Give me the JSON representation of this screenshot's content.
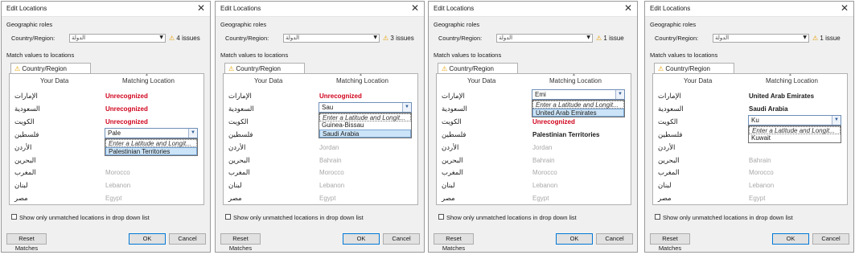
{
  "dialogs": [
    {
      "title": "Edit Locations",
      "geographic_roles_label": "Geographic roles",
      "country_region_label": "Country/Region:",
      "role_field_value": "الدولة",
      "issues": "4 issues",
      "match_label": "Match values to locations",
      "tab_label": "Country/Region",
      "col_your_data": "Your Data",
      "col_matching": "Matching Location",
      "rows": [
        {
          "data": "الإمارات",
          "match": "Unrecognized",
          "style": "unrec"
        },
        {
          "data": "السعودية",
          "match": "Unrecognized",
          "style": "unrec"
        },
        {
          "data": "الكويت",
          "match": "Unrecognized",
          "style": "unrec"
        },
        {
          "data": "فلسطين",
          "match": "",
          "style": "grey"
        },
        {
          "data": "الأردن",
          "match": "",
          "style": "grey"
        },
        {
          "data": "البحرين",
          "match": "",
          "style": "grey"
        },
        {
          "data": "المغرب",
          "match": "Morocco",
          "style": "grey"
        },
        {
          "data": "لبنان",
          "match": "Lebanon",
          "style": "grey"
        },
        {
          "data": "مصر",
          "match": "Egypt",
          "style": "grey"
        }
      ],
      "edit_value": "Pale",
      "edit_row": 3,
      "dropdown_hint": "Enter a Latitude and Longit...",
      "dropdown_items": [
        "Palestinian Territories"
      ],
      "selected_item": 0,
      "checkbox_label": "Show only unmatched locations in drop down list",
      "reset_label": "Reset Matches",
      "ok_label": "OK",
      "cancel_label": "Cancel"
    },
    {
      "title": "Edit Locations",
      "geographic_roles_label": "Geographic roles",
      "country_region_label": "Country/Region:",
      "role_field_value": "الدولة",
      "issues": "3 issues",
      "match_label": "Match values to locations",
      "tab_label": "Country/Region",
      "col_your_data": "Your Data",
      "col_matching": "Matching Location",
      "rows": [
        {
          "data": "الإمارات",
          "match": "Unrecognized",
          "style": "unrec"
        },
        {
          "data": "السعودية",
          "match": "",
          "style": "grey"
        },
        {
          "data": "الكويت",
          "match": "",
          "style": "grey"
        },
        {
          "data": "فلسطين",
          "match": "",
          "style": "grey"
        },
        {
          "data": "الأردن",
          "match": "Jordan",
          "style": "grey"
        },
        {
          "data": "البحرين",
          "match": "Bahrain",
          "style": "grey"
        },
        {
          "data": "المغرب",
          "match": "Morocco",
          "style": "grey"
        },
        {
          "data": "لبنان",
          "match": "Lebanon",
          "style": "grey"
        },
        {
          "data": "مصر",
          "match": "Egypt",
          "style": "grey"
        }
      ],
      "edit_value": "Sau",
      "edit_row": 1,
      "dropdown_hint": "Enter a Latitude and Longit...",
      "dropdown_items": [
        "Guinea-Bissau",
        "Saudi Arabia"
      ],
      "selected_item": 1,
      "checkbox_label": "Show only unmatched locations in drop down list",
      "reset_label": "Reset Matches",
      "ok_label": "OK",
      "cancel_label": "Cancel"
    },
    {
      "title": "Edit Locations",
      "geographic_roles_label": "Geographic roles",
      "country_region_label": "Country/Region:",
      "role_field_value": "الدولة",
      "issues": "1 issue",
      "match_label": "Match values to locations",
      "tab_label": "Country/Region",
      "col_your_data": "Your Data",
      "col_matching": "Matching Location",
      "rows": [
        {
          "data": "الإمارات",
          "match": "",
          "style": "grey"
        },
        {
          "data": "السعودية",
          "match": "",
          "style": "grey"
        },
        {
          "data": "الكويت",
          "match": "Unrecognized",
          "style": "unrec"
        },
        {
          "data": "فلسطين",
          "match": "Palestinian Territories",
          "style": "bold"
        },
        {
          "data": "الأردن",
          "match": "Jordan",
          "style": "grey"
        },
        {
          "data": "البحرين",
          "match": "Bahrain",
          "style": "grey"
        },
        {
          "data": "المغرب",
          "match": "Morocco",
          "style": "grey"
        },
        {
          "data": "لبنان",
          "match": "Lebanon",
          "style": "grey"
        },
        {
          "data": "مصر",
          "match": "Egypt",
          "style": "grey"
        }
      ],
      "edit_value": "Emi",
      "edit_row": 0,
      "dropdown_hint": "Enter a Latitude and Longit...",
      "dropdown_items": [
        "United Arab Emirates"
      ],
      "selected_item": 0,
      "checkbox_label": "Show only unmatched locations in drop down list",
      "reset_label": "Reset Matches",
      "ok_label": "OK",
      "cancel_label": "Cancel"
    },
    {
      "title": "Edit Locations",
      "geographic_roles_label": "Geographic roles",
      "country_region_label": "Country/Region:",
      "role_field_value": "الدولة",
      "issues": "1 issue",
      "match_label": "Match values to locations",
      "tab_label": "Country/Region",
      "col_your_data": "Your Data",
      "col_matching": "Matching Location",
      "rows": [
        {
          "data": "الإمارات",
          "match": "United Arab Emirates",
          "style": "bold"
        },
        {
          "data": "السعودية",
          "match": "Saudi Arabia",
          "style": "bold"
        },
        {
          "data": "الكويت",
          "match": "",
          "style": "grey"
        },
        {
          "data": "فلسطين",
          "match": "",
          "style": "grey"
        },
        {
          "data": "الأردن",
          "match": "",
          "style": "grey"
        },
        {
          "data": "البحرين",
          "match": "Bahrain",
          "style": "grey"
        },
        {
          "data": "المغرب",
          "match": "Morocco",
          "style": "grey"
        },
        {
          "data": "لبنان",
          "match": "Lebanon",
          "style": "grey"
        },
        {
          "data": "مصر",
          "match": "Egypt",
          "style": "grey"
        }
      ],
      "edit_value": "Ku",
      "edit_row": 2,
      "dropdown_hint": "Enter a Latitude and Longit...",
      "dropdown_items": [
        "Kuwait"
      ],
      "selected_item": -1,
      "checkbox_label": "Show only unmatched locations in drop down list",
      "reset_label": "Reset Matches",
      "ok_label": "OK",
      "cancel_label": "Cancel"
    }
  ],
  "icons": {
    "close": "close-icon",
    "warning": "warning-icon",
    "dropdown_arrow": "chevron-down-icon"
  },
  "colors": {
    "unrecognized": "#d0021b",
    "warning": "#e8a000",
    "selection": "#cce4f7"
  }
}
